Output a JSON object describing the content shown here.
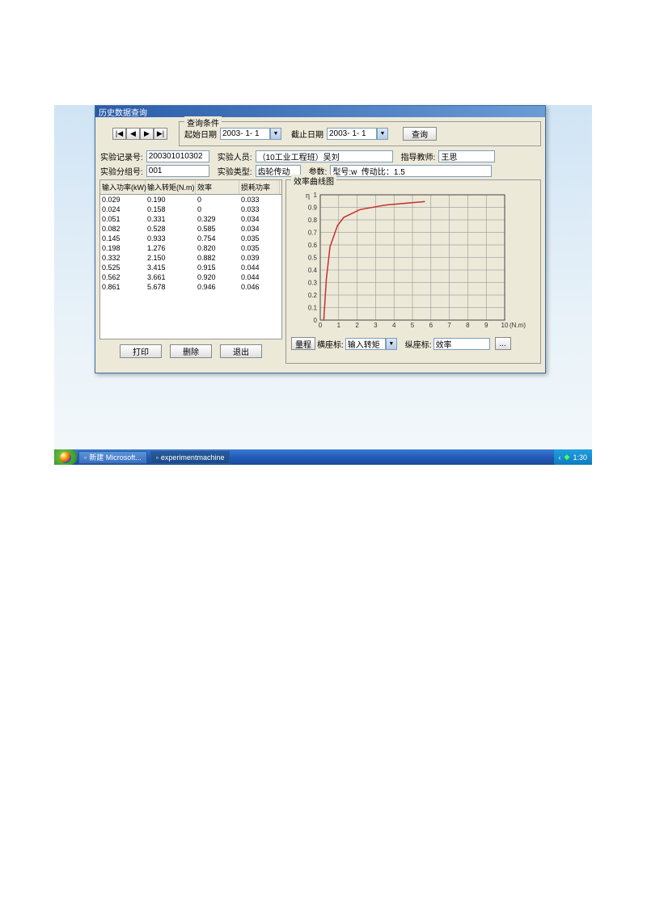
{
  "window": {
    "title": "历史数据查询"
  },
  "nav": {
    "first": "|◀",
    "prev": "◀",
    "next": "▶",
    "last": "▶|"
  },
  "query": {
    "group_label": "查询条件",
    "start_date_label": "起始日期",
    "start_date": "2003- 1- 1",
    "end_date_label": "截止日期",
    "end_date": "2003- 1- 1",
    "query_btn": "查询"
  },
  "form": {
    "record_no_label": "实验记录号:",
    "record_no": "200301010302",
    "person_label": "实验人员:",
    "person": "（10工业工程班）吴刘",
    "teacher_label": "指导教师:",
    "teacher": "王思",
    "group_no_label": "实验分组号:",
    "group_no": "001",
    "type_label": "实验类型:",
    "type": "齿轮传动",
    "params_label": "参数:",
    "params": "型号:w  传动比：1.5"
  },
  "grid": {
    "headers": [
      "输入功率(kW)",
      "输入转矩(N.m)",
      "效率",
      "损耗功率"
    ],
    "rows": [
      [
        "0.029",
        "0.190",
        "0",
        "0.033"
      ],
      [
        "0.024",
        "0.158",
        "0",
        "0.033"
      ],
      [
        "0.051",
        "0.331",
        "0.329",
        "0.034"
      ],
      [
        "0.082",
        "0.528",
        "0.585",
        "0.034"
      ],
      [
        "0.145",
        "0.933",
        "0.754",
        "0.035"
      ],
      [
        "0.198",
        "1.276",
        "0.820",
        "0.035"
      ],
      [
        "0.332",
        "2.150",
        "0.882",
        "0.039"
      ],
      [
        "0.525",
        "3.415",
        "0.915",
        "0.044"
      ],
      [
        "0.562",
        "3.661",
        "0.920",
        "0.044"
      ],
      [
        "0.861",
        "5.678",
        "0.946",
        "0.046"
      ]
    ]
  },
  "actions": {
    "print": "打印",
    "delete": "删除",
    "exit": "退出"
  },
  "chart": {
    "group_label": "效率曲线图",
    "y_label": "η",
    "x_unit": "(N.m)",
    "range_btn": "量程",
    "x_axis_label": "横座标:",
    "x_axis_value": "输入转矩",
    "y_axis_label": "纵座标:",
    "y_axis_value": "效率",
    "more_btn": "..."
  },
  "chart_data": {
    "type": "line",
    "title": "效率曲线图",
    "xlabel": "输入转矩 (N.m)",
    "ylabel": "效率 η",
    "xlim": [
      0,
      10
    ],
    "ylim": [
      0,
      1
    ],
    "x_ticks": [
      0,
      1,
      2,
      3,
      4,
      5,
      6,
      7,
      8,
      9,
      10
    ],
    "y_ticks": [
      0,
      0.1,
      0.2,
      0.3,
      0.4,
      0.5,
      0.6,
      0.7,
      0.8,
      0.9,
      1
    ],
    "series": [
      {
        "name": "效率",
        "x": [
          0.158,
          0.19,
          0.331,
          0.528,
          0.933,
          1.276,
          2.15,
          3.415,
          3.661,
          5.678
        ],
        "y": [
          0,
          0,
          0.329,
          0.585,
          0.754,
          0.82,
          0.882,
          0.915,
          0.92,
          0.946
        ],
        "color": "#c83030"
      }
    ]
  },
  "taskbar": {
    "items": [
      {
        "label": "新建 Microsoft...",
        "active": false
      },
      {
        "label": "experimentmachine",
        "active": true
      }
    ],
    "clock": "1:30"
  }
}
